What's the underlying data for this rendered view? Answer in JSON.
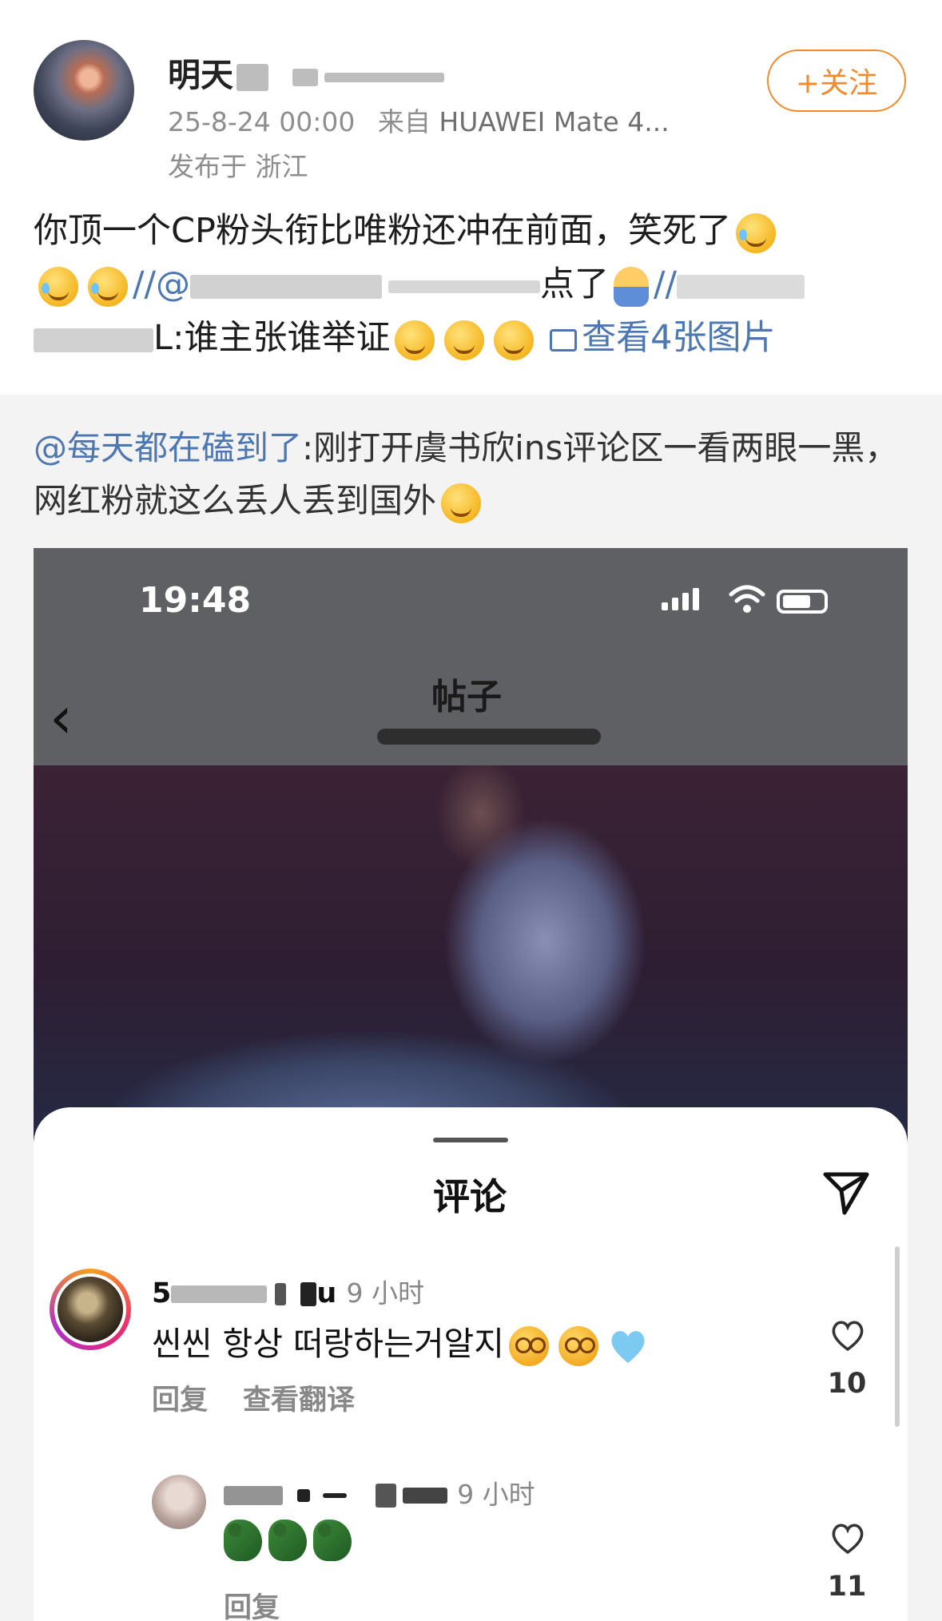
{
  "post": {
    "username": "明天",
    "date": "25-8-24 00:00",
    "source_prefix": "来自",
    "device": "HUAWEI Mate 4...",
    "location": "发布于 浙江",
    "follow_label": "+关注",
    "text_part1": "你顶一个CP粉头衔比唯粉还冲在前面，笑死了",
    "text_mention1": "//@",
    "text_part2": "点了",
    "text_mention2": "//",
    "text_part3": "L:谁主张谁举证",
    "view_images": "查看4张图片"
  },
  "repost": {
    "mention": "@每天都在磕到了",
    "text": ":刚打开虞书欣ins评论区一看两眼一黑，网红粉就这么丢人丢到国外"
  },
  "embedded": {
    "status_time": "19:48",
    "page_title": "帖子",
    "comments_title": "评论",
    "comments": [
      {
        "name": "5",
        "name_suffix": "u",
        "time": "9 小时",
        "text": "씬씬 항상 떠랑하는거알지",
        "reply": "回复",
        "translate": "查看翻译",
        "likes": "10"
      },
      {
        "time": "9 小时",
        "reply": "回复",
        "likes": "11"
      }
    ]
  }
}
